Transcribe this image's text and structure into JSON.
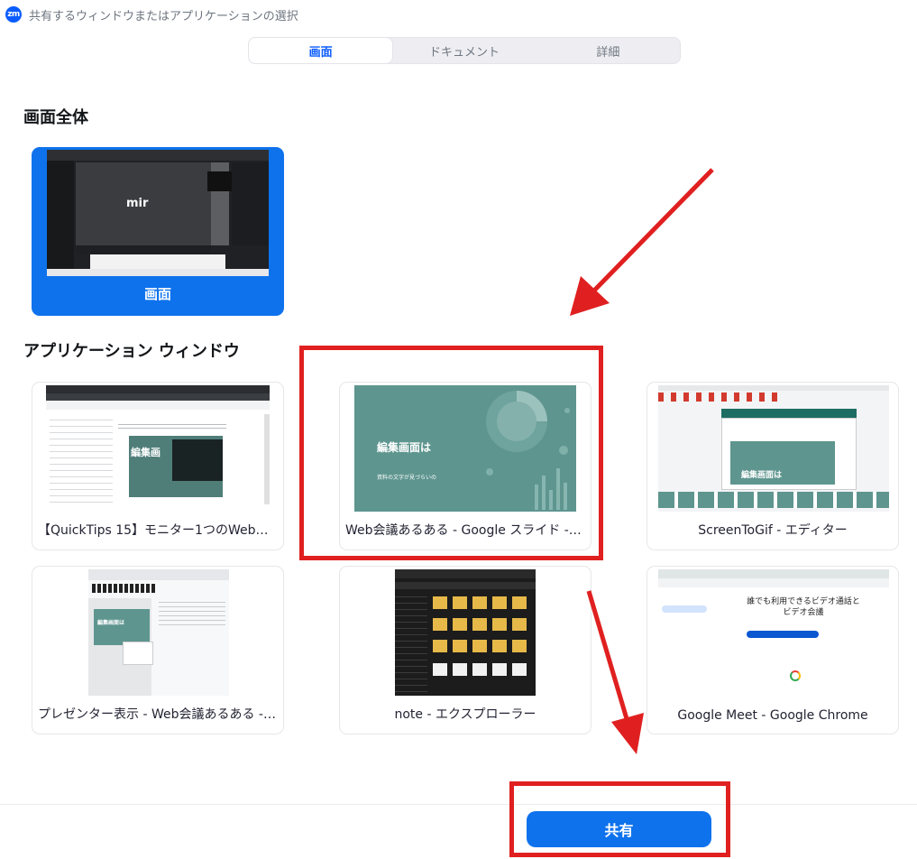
{
  "window": {
    "app_icon_text": "zm",
    "title": "共有するウィンドウまたはアプリケーションの選択"
  },
  "tabs": [
    {
      "label": "画面",
      "active": true
    },
    {
      "label": "ドキュメント",
      "active": false
    },
    {
      "label": "詳細",
      "active": false
    }
  ],
  "sections": {
    "full_screen": "画面全体",
    "app_windows": "アプリケーション ウィンドウ"
  },
  "full_screen_option": {
    "label": "画面",
    "thumb_text": "mir"
  },
  "apps": [
    {
      "label": "【QuickTips 15】モニター1つのWeb会議（…",
      "thumb_text": "編集画"
    },
    {
      "label": "Web会議あるある - Google スライド - Go…",
      "thumb_text": "編集画面は",
      "thumb_subtext": "資料の文字が見づらいの"
    },
    {
      "label": "ScreenToGif - エディター",
      "thumb_text": "編集画面は"
    },
    {
      "label": "プレゼンター表示 - Web会議あるある - G…",
      "thumb_text": "編集画面は"
    },
    {
      "label": "note - エクスプローラー"
    },
    {
      "label": "Google Meet - Google Chrome",
      "thumb_text": "誰でも利用できるビデオ通話とビデオ会議"
    }
  ],
  "footer": {
    "share_label": "共有"
  },
  "colors": {
    "accent": "#0e72ed",
    "annotation_red": "#e02020",
    "slide_teal": "#5e958f"
  }
}
